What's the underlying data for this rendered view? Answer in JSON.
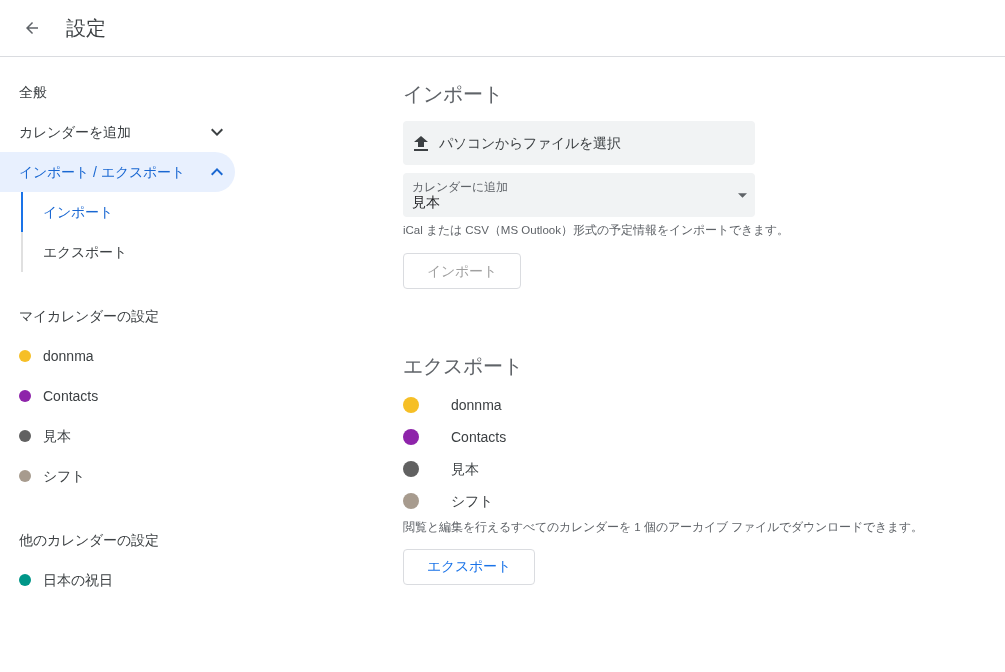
{
  "header": {
    "title": "設定"
  },
  "sidebar": {
    "nav": [
      {
        "label": "全般",
        "selected": false
      },
      {
        "label": "カレンダーを追加",
        "selected": false,
        "expanded": false
      },
      {
        "label": "インポート / エクスポート",
        "selected": true,
        "expanded": true,
        "children": [
          {
            "label": "インポート",
            "selected": true
          },
          {
            "label": "エクスポート",
            "selected": false
          }
        ]
      }
    ],
    "groups": [
      {
        "heading": "マイカレンダーの設定",
        "calendars": [
          {
            "name": "donnma",
            "color": "#f6bf26"
          },
          {
            "name": "Contacts",
            "color": "#8e24aa"
          },
          {
            "name": "見本",
            "color": "#616161"
          },
          {
            "name": "シフト",
            "color": "#a79b8e"
          }
        ]
      },
      {
        "heading": "他のカレンダーの設定",
        "calendars": [
          {
            "name": "日本の祝日",
            "color": "#009688"
          }
        ]
      }
    ]
  },
  "import": {
    "title": "インポート",
    "file_button": "パソコンからファイルを選択",
    "select": {
      "label": "カレンダーに追加",
      "value": "見本"
    },
    "hint": "iCal または CSV（MS Outlook）形式の予定情報をインポートできます。",
    "button": {
      "label": "インポート",
      "disabled": true
    }
  },
  "export": {
    "title": "エクスポート",
    "calendars": [
      {
        "name": "donnma",
        "color": "#f6bf26"
      },
      {
        "name": "Contacts",
        "color": "#8e24aa"
      },
      {
        "name": "見本",
        "color": "#616161"
      },
      {
        "name": "シフト",
        "color": "#a79b8e"
      }
    ],
    "hint": "閲覧と編集を行えるすべてのカレンダーを 1 個のアーカイブ ファイルでダウンロードできます。",
    "button": {
      "label": "エクスポート",
      "disabled": false
    }
  }
}
